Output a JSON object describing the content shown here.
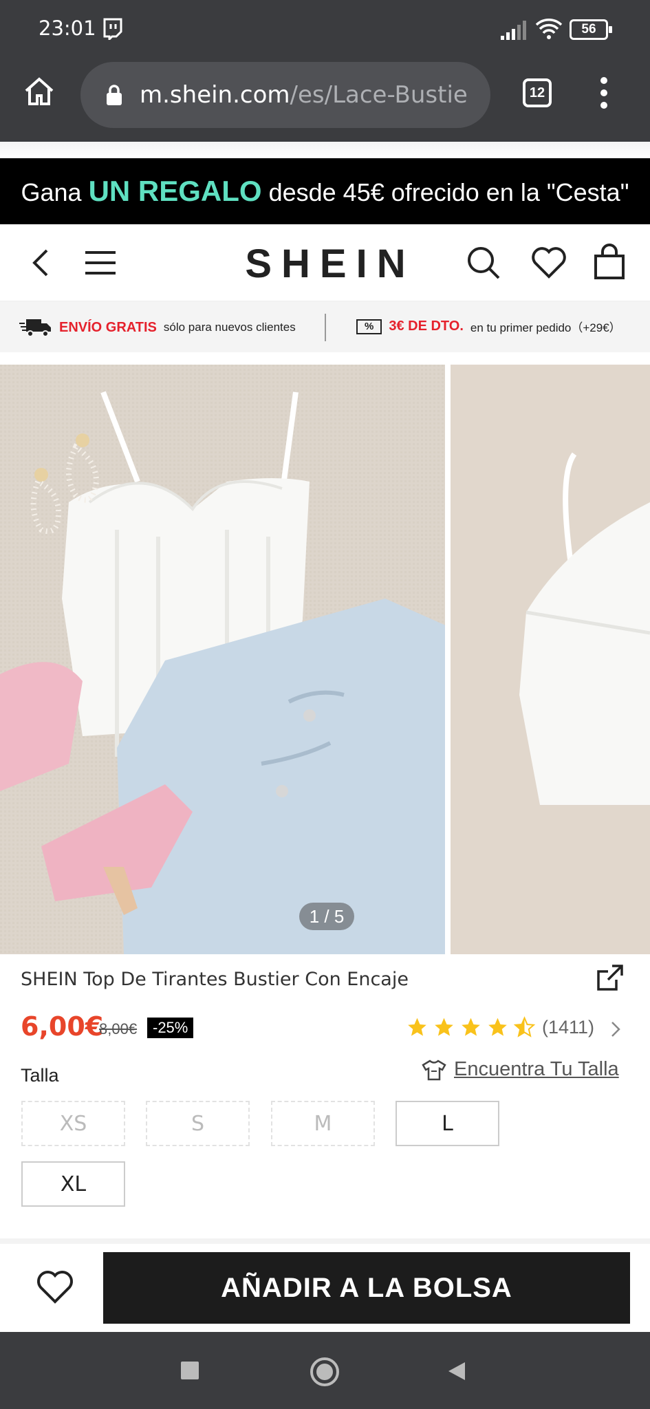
{
  "status": {
    "time": "23:01",
    "battery": "56"
  },
  "browser": {
    "url_host": "m.shein.com",
    "url_path": "/es/Lace-Bustie",
    "tab_count": "12"
  },
  "promo": {
    "prefix": "Gana ",
    "highlight": "UN REGALO",
    "suffix": " desde 45€ ofrecido en la \"Cesta\""
  },
  "header": {
    "logo": "SHEIN"
  },
  "shipping": {
    "free_label": "ENVÍO GRATIS",
    "free_note": "sólo para nuevos clientes",
    "coupon_icon": "%",
    "discount_label": "3€ DE DTO.",
    "discount_note": "en tu primer pedido（+29€）"
  },
  "gallery": {
    "counter": "1 / 5"
  },
  "product": {
    "title": "SHEIN Top De Tirantes Bustier Con Encaje",
    "price": "6,00€",
    "old_price": "8,00€",
    "discount": "-25%",
    "rating_stars": 4.5,
    "review_count": "(1411)"
  },
  "size_section": {
    "label": "Talla",
    "find_label": "Encuentra Tu Talla",
    "options": [
      {
        "label": "XS",
        "available": false
      },
      {
        "label": "S",
        "available": false
      },
      {
        "label": "M",
        "available": false
      },
      {
        "label": "L",
        "available": true
      },
      {
        "label": "XL",
        "available": true
      }
    ]
  },
  "actions": {
    "add_to_bag": "AÑADIR A LA BOLSA"
  },
  "colors": {
    "accent": "#e8452a",
    "promo_highlight": "#5fe0c1",
    "star": "#f9c21b",
    "shipping_red": "#e5212c"
  }
}
